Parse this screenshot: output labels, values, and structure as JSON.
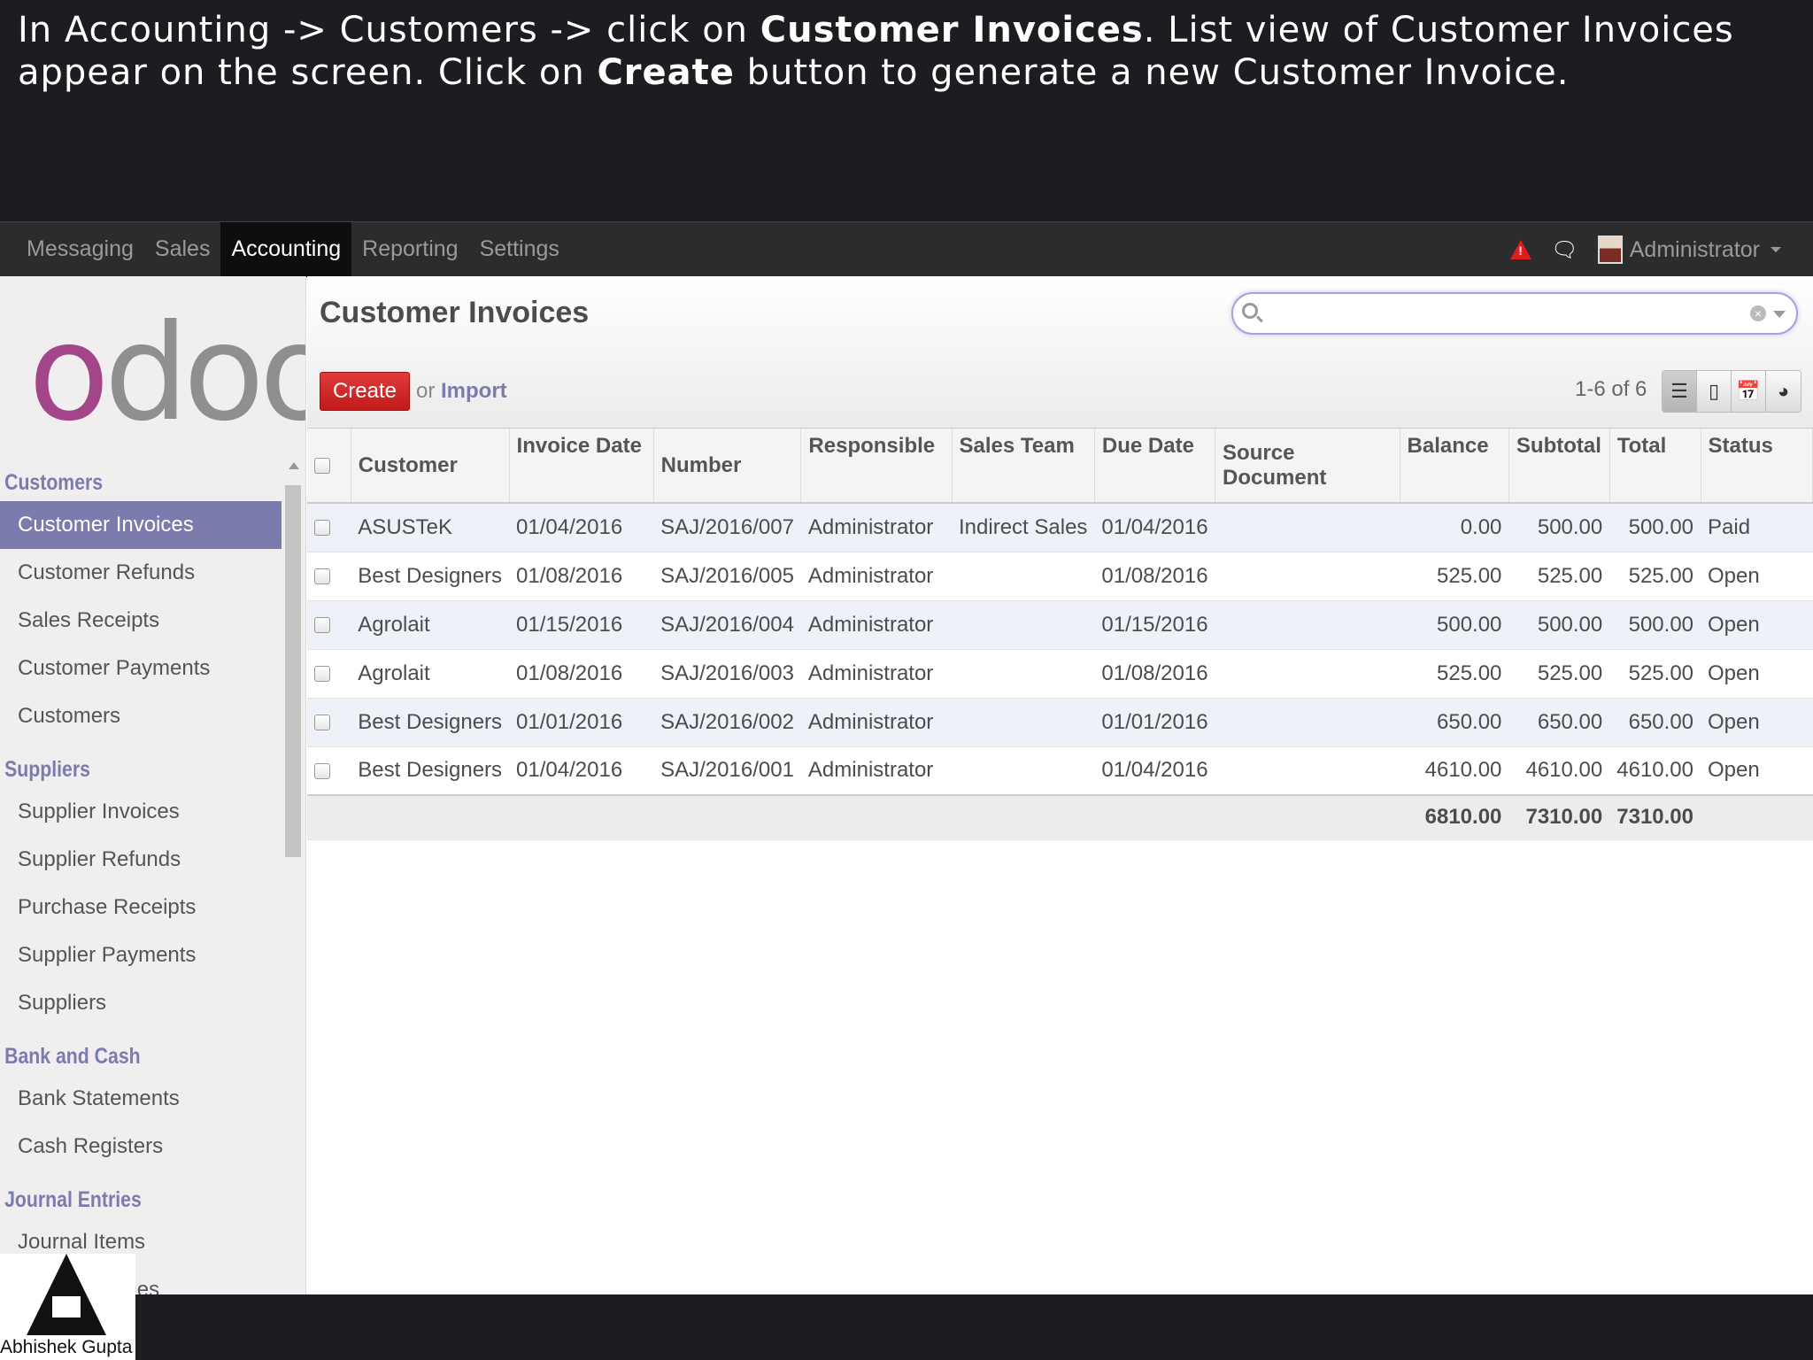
{
  "caption": {
    "part1": "In Accounting -> Customers -> click on ",
    "bold1": "Customer Invoices",
    "part2": ". List view of Customer Invoices appear on the screen. Click on ",
    "bold2": "Create",
    "part3": " button to generate a new Customer Invoice."
  },
  "topbar": {
    "menu": [
      "Messaging",
      "Sales",
      "Accounting",
      "Reporting",
      "Settings"
    ],
    "active_menu": "Accounting",
    "user": "Administrator"
  },
  "sidebar": {
    "logo": "odoo",
    "sections": [
      {
        "title": "Customers",
        "items": [
          "Customer Invoices",
          "Customer Refunds",
          "Sales Receipts",
          "Customer Payments",
          "Customers"
        ]
      },
      {
        "title": "Suppliers",
        "items": [
          "Supplier Invoices",
          "Supplier Refunds",
          "Purchase Receipts",
          "Supplier Payments",
          "Suppliers"
        ]
      },
      {
        "title": "Bank and Cash",
        "items": [
          "Bank Statements",
          "Cash Registers"
        ]
      },
      {
        "title": "Journal Entries",
        "items": [
          "Journal Items",
          "Journal Entries"
        ]
      }
    ],
    "active_item": "Customer Invoices"
  },
  "main": {
    "title": "Customer Invoices",
    "search": {
      "placeholder": "",
      "value": ""
    },
    "create_label": "Create",
    "or_text": "or",
    "import_label": "Import",
    "pager": "1-6 of 6",
    "columns": [
      "Customer",
      "Invoice Date",
      "Number",
      "Responsible",
      "Sales Team",
      "Due Date",
      "Source Document",
      "Balance",
      "Subtotal",
      "Total",
      "Status"
    ],
    "rows": [
      {
        "customer": "ASUSTeK",
        "invoice_date": "01/04/2016",
        "number": "SAJ/2016/007",
        "responsible": "Administrator",
        "sales_team": "Indirect Sales",
        "due_date": "01/04/2016",
        "source": "",
        "balance": "0.00",
        "subtotal": "500.00",
        "total": "500.00",
        "status": "Paid"
      },
      {
        "customer": "Best Designers",
        "invoice_date": "01/08/2016",
        "number": "SAJ/2016/005",
        "responsible": "Administrator",
        "sales_team": "",
        "due_date": "01/08/2016",
        "source": "",
        "balance": "525.00",
        "subtotal": "525.00",
        "total": "525.00",
        "status": "Open"
      },
      {
        "customer": "Agrolait",
        "invoice_date": "01/15/2016",
        "number": "SAJ/2016/004",
        "responsible": "Administrator",
        "sales_team": "",
        "due_date": "01/15/2016",
        "source": "",
        "balance": "500.00",
        "subtotal": "500.00",
        "total": "500.00",
        "status": "Open"
      },
      {
        "customer": "Agrolait",
        "invoice_date": "01/08/2016",
        "number": "SAJ/2016/003",
        "responsible": "Administrator",
        "sales_team": "",
        "due_date": "01/08/2016",
        "source": "",
        "balance": "525.00",
        "subtotal": "525.00",
        "total": "525.00",
        "status": "Open"
      },
      {
        "customer": "Best Designers",
        "invoice_date": "01/01/2016",
        "number": "SAJ/2016/002",
        "responsible": "Administrator",
        "sales_team": "",
        "due_date": "01/01/2016",
        "source": "",
        "balance": "650.00",
        "subtotal": "650.00",
        "total": "650.00",
        "status": "Open"
      },
      {
        "customer": "Best Designers",
        "invoice_date": "01/04/2016",
        "number": "SAJ/2016/001",
        "responsible": "Administrator",
        "sales_team": "",
        "due_date": "01/04/2016",
        "source": "",
        "balance": "4610.00",
        "subtotal": "4610.00",
        "total": "4610.00",
        "status": "Open"
      }
    ],
    "totals": {
      "balance": "6810.00",
      "subtotal": "7310.00",
      "total": "7310.00"
    }
  },
  "watermark": {
    "text": "Abhishek Gupta"
  },
  "colors": {
    "accent": "#7c7bad",
    "create_button": "#d42a2a",
    "topbar": "#2c2c2c",
    "logo_o": "#a24689"
  }
}
